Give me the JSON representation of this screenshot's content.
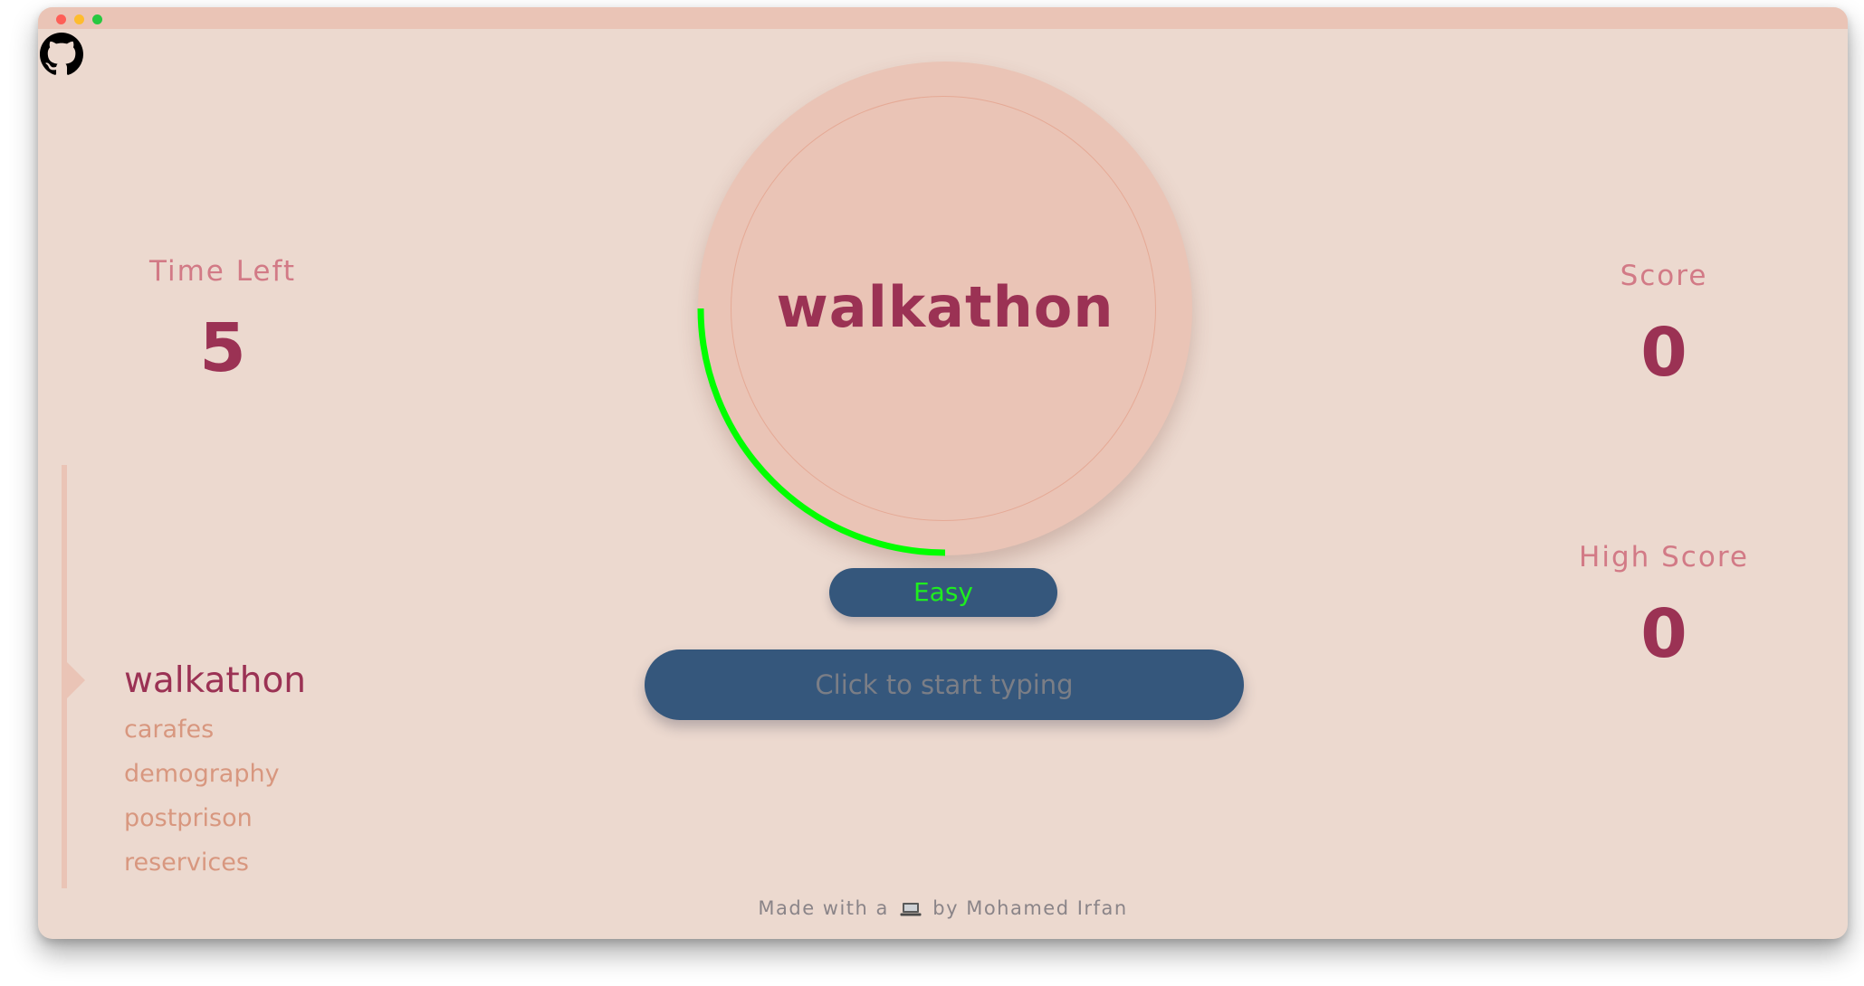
{
  "window": {
    "controls": [
      "close",
      "minimize",
      "maximize"
    ]
  },
  "header": {
    "github_icon": "github-icon"
  },
  "time_left": {
    "label": "Time Left",
    "value": "5"
  },
  "score": {
    "label": "Score",
    "value": "0"
  },
  "high_score": {
    "label": "High Score",
    "value": "0"
  },
  "game": {
    "current_word": "walkathon",
    "timer_progress_fraction": 0.25,
    "timer_color": "#00ff00",
    "difficulty": "Easy",
    "difficulty_color": "#1fee1f",
    "input_placeholder": "Click to start typing"
  },
  "word_list": {
    "items": [
      "walkathon",
      "carafes",
      "demography",
      "postprison",
      "reservices"
    ],
    "active_index": 0
  },
  "footer": {
    "prefix": "Made with a",
    "icon": "laptop-icon",
    "suffix": "by Mohamed Irfan"
  },
  "colors": {
    "background": "#ecd9cf",
    "accent_dark": "#9b3254",
    "accent_label": "#d27a86",
    "button_blue": "#35577c",
    "circle_fill": "#eac4b6"
  }
}
